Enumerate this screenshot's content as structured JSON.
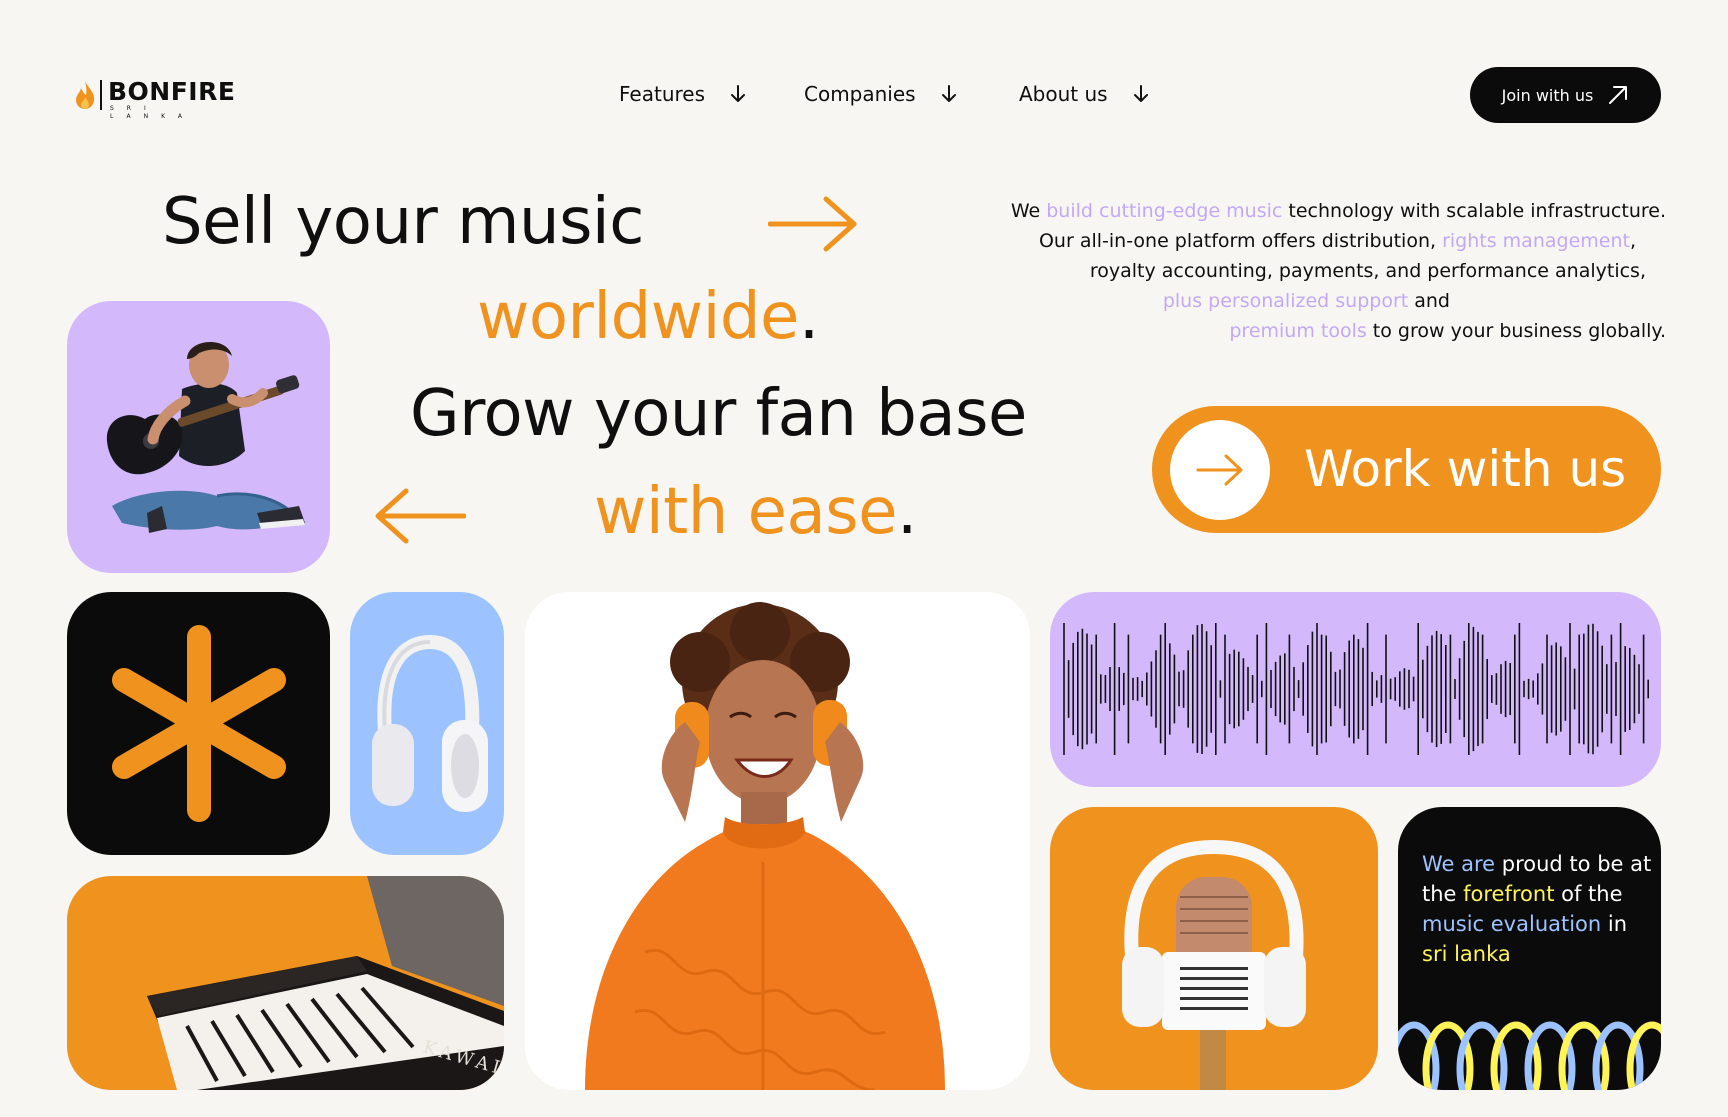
{
  "brand": {
    "name": "BONFIRE",
    "sub": "SRI LANKA"
  },
  "nav": [
    {
      "label": "Features",
      "icon": "arrow-down-icon"
    },
    {
      "label": "Companies",
      "icon": "arrow-down-icon"
    },
    {
      "label": "About us",
      "icon": "arrow-down-icon"
    }
  ],
  "join_button": {
    "label": "Join with us",
    "icon": "arrow-up-right-icon"
  },
  "hero": {
    "line1": "Sell your music",
    "line2": "worldwide",
    "line3": "Grow your fan base",
    "line4": "with ease",
    "period": "."
  },
  "description": {
    "l1_a": "We ",
    "l1_b": "build cutting-edge music",
    "l1_c": " technology with scalable infrastructure.",
    "l2_a": "Our all-in-one platform offers distribution, ",
    "l2_b": "rights management",
    "l2_c": ",",
    "l3": "royalty accounting, payments, and performance analytics,",
    "l4_a": "plus personalized support",
    "l4_b": " and",
    "l5_a": "premium tools",
    "l5_b": " to grow your business globally."
  },
  "work_button": {
    "label": "Work with us",
    "icon": "arrow-right-icon"
  },
  "proud_card": {
    "t1": "We are",
    "t2": " proud to be at the ",
    "t3": "forefront",
    "t4": " of the ",
    "t5": "music evaluation",
    "t6": " in ",
    "t7": "sri lanka"
  },
  "piano_brand": "KAWAI",
  "colors": {
    "orange": "#f0921e",
    "purple": "#d3b8fb",
    "blue": "#9cc3ff",
    "black": "#0b0b0b",
    "bg": "#f7f6f3"
  }
}
